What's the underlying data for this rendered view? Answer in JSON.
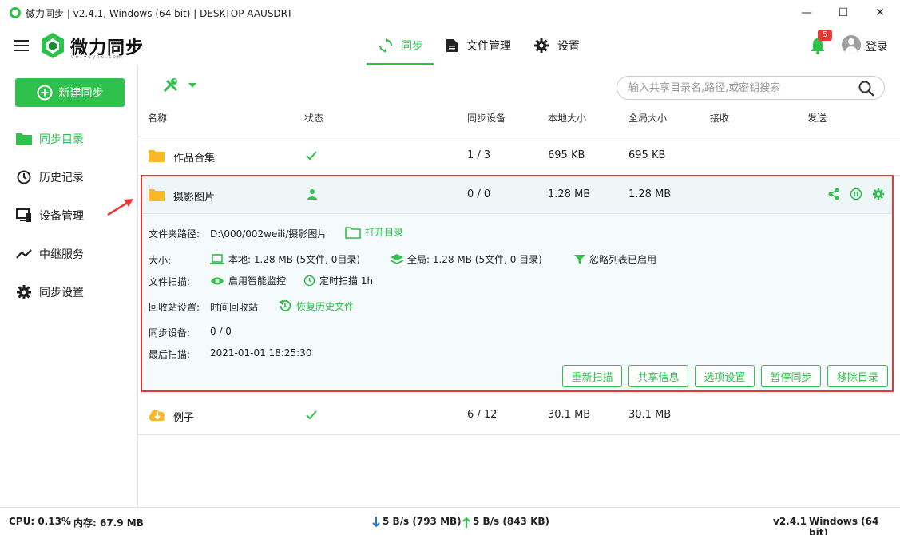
{
  "window": {
    "title": "微力同步 | v2.4.1, Windows (64 bit) | DESKTOP-AAUSDRT",
    "minimize": "—",
    "maximize": "☐",
    "close": "✕"
  },
  "header": {
    "logo_text": "微力同步",
    "logo_sub": "verysync.com",
    "tabs": [
      {
        "label": "同步",
        "active": true,
        "icon": "sync-icon"
      },
      {
        "label": "文件管理",
        "active": false,
        "icon": "file-icon"
      },
      {
        "label": "设置",
        "active": false,
        "icon": "gear-icon"
      }
    ],
    "notification_count": "5",
    "login_label": "登录"
  },
  "sidebar": {
    "new_button": "新建同步",
    "items": [
      {
        "label": "同步目录",
        "icon": "folder-icon",
        "active": true
      },
      {
        "label": "历史记录",
        "icon": "history-icon",
        "active": false
      },
      {
        "label": "设备管理",
        "icon": "devices-icon",
        "active": false
      },
      {
        "label": "中继服务",
        "icon": "relay-icon",
        "active": false
      },
      {
        "label": "同步设置",
        "icon": "gear-icon",
        "active": false
      }
    ]
  },
  "search": {
    "placeholder": "输入共享目录名,路径,或密钥搜索"
  },
  "table": {
    "headers": [
      "名称",
      "状态",
      "同步设备",
      "本地大小",
      "全局大小",
      "接收",
      "发送"
    ],
    "rows": [
      {
        "name": "作品合集",
        "status": "ok",
        "devices": "1 / 3",
        "local": "695 KB",
        "global": "695 KB"
      },
      {
        "name": "摄影图片",
        "status": "person",
        "devices": "0 / 0",
        "local": "1.28 MB",
        "global": "1.28 MB"
      },
      {
        "name": "例子",
        "status": "ok",
        "devices": "6 / 12",
        "local": "30.1 MB",
        "global": "30.1 MB"
      }
    ]
  },
  "detail": {
    "path_label": "文件夹路径:",
    "path_value": "D:\\000/002weili/摄影图片",
    "open_dir": "打开目录",
    "size_label": "大小:",
    "local_size": "本地: 1.28 MB (5文件, 0目录)",
    "global_size": "全局: 1.28 MB (5文件, 0 目录)",
    "ignore_list": "忽略列表已启用",
    "scan_label": "文件扫描:",
    "smart_monitor": "启用智能监控",
    "timed_scan": "定时扫描 1h",
    "recycle_label": "回收站设置:",
    "recycle_value": "时间回收站",
    "restore_history": "恢复历史文件",
    "sync_devices_label": "同步设备:",
    "sync_devices_value": "0 / 0",
    "last_scan_label": "最后扫描:",
    "last_scan_value": "2021-01-01 18:25:30",
    "buttons": [
      "重新扫描",
      "共享信息",
      "选项设置",
      "暂停同步",
      "移除目录"
    ]
  },
  "statusbar": {
    "cpu": "CPU: 0.13%",
    "memory": "内存: 67.9 MB",
    "download": "5 B/s (793 MB)",
    "upload": "5 B/s (843 KB)",
    "version": "v2.4.1",
    "os": "Windows (64 bit)"
  },
  "colors": {
    "accent": "#2ec14b",
    "highlight_border": "#e53935",
    "folder": "#f7b928"
  }
}
